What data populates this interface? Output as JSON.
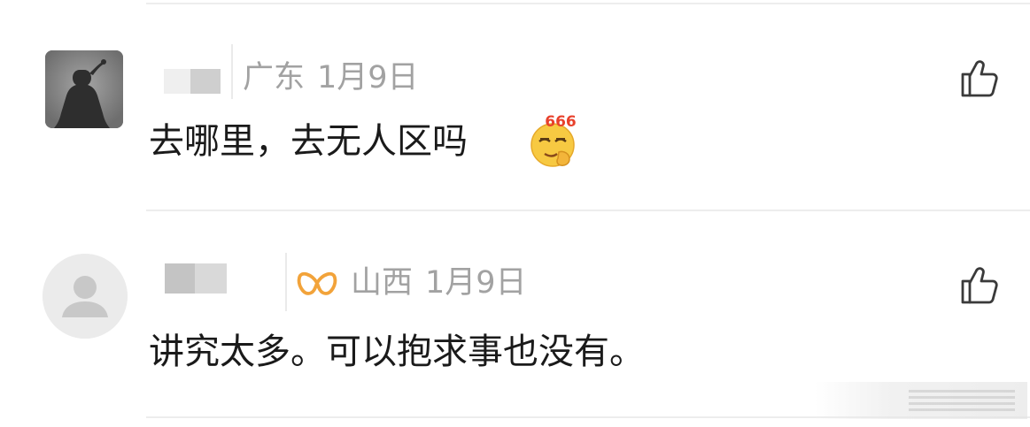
{
  "comments": [
    {
      "location": "广东",
      "date": "1月9日",
      "text": "去哪里，去无人区吗",
      "emoji": "666-emoji",
      "emoji_text": "666",
      "like_icon": "thumbs-up-outline-icon",
      "avatar": "photo-avatar"
    },
    {
      "location": "山西",
      "date": "1月9日",
      "text": "讲究太多。可以抱求事也没有。",
      "badge": "orange-loop-badge-icon",
      "like_icon": "thumbs-up-outline-icon",
      "avatar": "default-user-avatar"
    }
  ],
  "colors": {
    "meta_text": "#a2a2a2",
    "comment_text": "#1a1a1a",
    "divider": "#ededed",
    "badge": "#f2a33a",
    "emoji_face": "#f7c942",
    "emoji_badge_text": "#e8412c"
  }
}
